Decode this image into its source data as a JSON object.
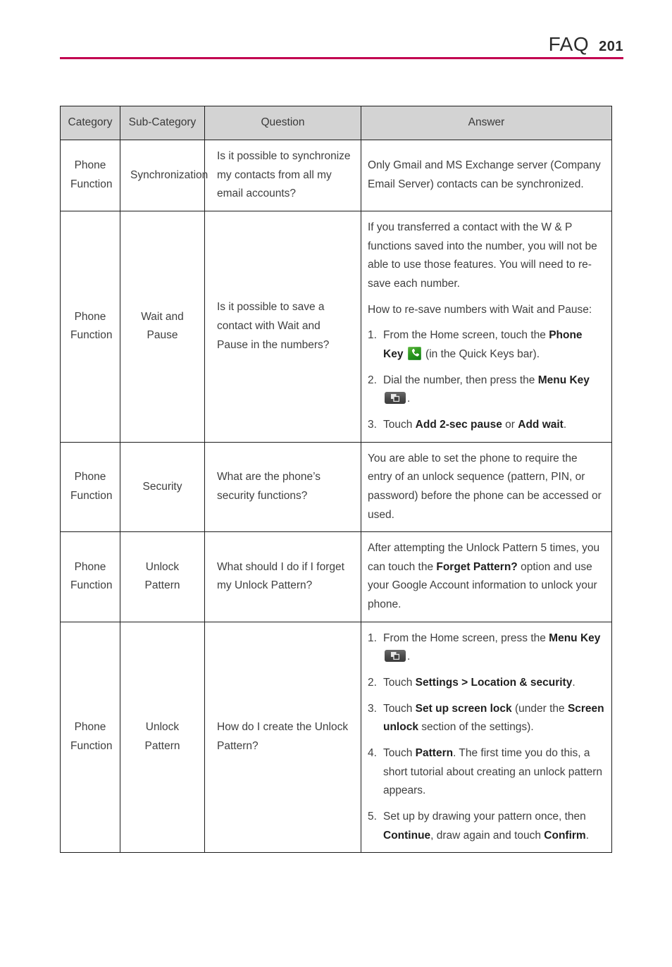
{
  "header": {
    "title": "FAQ",
    "page_number": "201",
    "rule_color": "#c2004f"
  },
  "table": {
    "columns": [
      "Category",
      "Sub-Category",
      "Question",
      "Answer"
    ],
    "header_bg": "#d3d3d3",
    "rows": [
      {
        "category": "Phone Function",
        "sub_category": "Synchronization",
        "question": "Is it possible to synchronize my contacts from all my email accounts?",
        "answer_paragraphs": [
          "Only Gmail and MS Exchange server (Company Email Server) contacts can be synchronized."
        ]
      },
      {
        "category": "Phone Function",
        "sub_category": "Wait and Pause",
        "question": "Is it possible to save a contact with Wait and Pause in the numbers?",
        "answer_paragraphs": [
          "If you transferred a contact with the W & P functions saved into the number, you will not be able to use those features. You will need to re-save each number.",
          "How to re-save numbers with Wait and Pause:"
        ],
        "steps": [
          {
            "num": "1.",
            "prefix": "From the Home screen, touch the ",
            "bold": "Phone Key",
            "icon": "phone-key-icon",
            "suffix": " (in the Quick Keys bar)."
          },
          {
            "num": "2.",
            "prefix": "Dial the number, then press the ",
            "bold": "Menu Key",
            "icon": "menu-key-icon",
            "suffix": "."
          },
          {
            "num": "3.",
            "prefix": "Touch ",
            "bold": "Add 2-sec pause",
            "middle": " or ",
            "bold2": "Add wait",
            "suffix": "."
          }
        ]
      },
      {
        "category": "Phone Function",
        "sub_category": "Security",
        "question": "What are the phone’s security functions?",
        "answer_paragraphs": [
          "You are able to set the phone to require the entry of an unlock sequence (pattern, PIN, or password) before the phone can be accessed or used."
        ]
      },
      {
        "category": "Phone Function",
        "sub_category": "Unlock Pattern",
        "question": "What should I do if I forget my Unlock Pattern?",
        "answer_rich": {
          "part1": "After attempting the Unlock Pattern 5 times, you can touch the ",
          "bold": "Forget Pattern?",
          "part2": " option and use your Google Account information to unlock your phone."
        }
      },
      {
        "category": "Phone Function",
        "sub_category": "Unlock Pattern",
        "question": "How do I create the Unlock Pattern?",
        "steps": [
          {
            "num": "1.",
            "prefix": "From the Home screen, press the ",
            "bold": "Menu Key",
            "icon": "menu-key-icon",
            "suffix": "."
          },
          {
            "num": "2.",
            "prefix": "Touch ",
            "bold": "Settings > Location & security",
            "suffix": "."
          },
          {
            "num": "3.",
            "prefix": "Touch ",
            "bold": "Set up screen lock",
            "middle": " (under the ",
            "bold2": "Screen unlock",
            "suffix": " section of the settings)."
          },
          {
            "num": "4.",
            "prefix": "Touch ",
            "bold": "Pattern",
            "suffix": ". The first time you do this, a short tutorial about creating an unlock pattern appears."
          },
          {
            "num": "5.",
            "prefix": "Set up by drawing your pattern once, then ",
            "bold": "Continue",
            "middle": ", draw again and touch ",
            "bold2": "Confirm",
            "suffix": "."
          }
        ]
      }
    ]
  }
}
